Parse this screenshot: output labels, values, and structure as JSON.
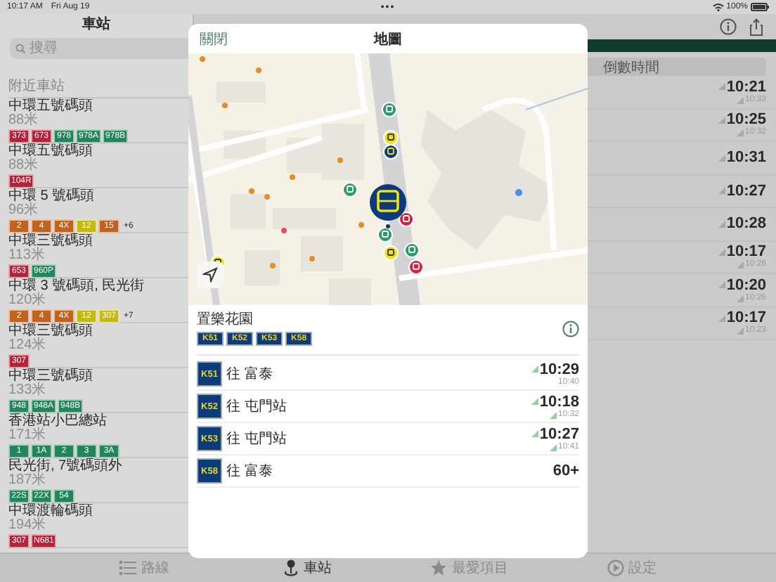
{
  "status_bar": {
    "time": "10:17 AM",
    "date": "Fri Aug 19",
    "dots": "•••",
    "battery": "100%"
  },
  "sidebar": {
    "title": "車站",
    "search": {
      "placeholder": "搜尋"
    },
    "section": "附近車站",
    "stops": [
      {
        "name": "中環五號碼頭",
        "distance": "88米",
        "routes": [
          {
            "label": "373",
            "color": "#b3243a"
          },
          {
            "label": "673",
            "color": "#b3243a"
          },
          {
            "label": "978",
            "color": "#23865a"
          },
          {
            "label": "978A",
            "color": "#23865a"
          },
          {
            "label": "978B",
            "color": "#23865a"
          }
        ]
      },
      {
        "name": "中環五號碼頭",
        "distance": "88米",
        "routes": [
          {
            "label": "104R",
            "color": "#b3243a"
          }
        ]
      },
      {
        "name": "中環 5 號碼頭",
        "distance": "96米",
        "routes": [
          {
            "label": "2",
            "color": "#c2621f"
          },
          {
            "label": "4",
            "color": "#c2621f"
          },
          {
            "label": "4X",
            "color": "#c2621f"
          },
          {
            "label": "12",
            "color": "#c4b812"
          },
          {
            "label": "15",
            "color": "#c2621f"
          }
        ],
        "more": "+6"
      },
      {
        "name": "中環三號碼頭",
        "distance": "113米",
        "routes": [
          {
            "label": "653",
            "color": "#b3243a"
          },
          {
            "label": "960P",
            "color": "#23865a"
          }
        ]
      },
      {
        "name": "中環 3 號碼頭, 民光街",
        "distance": "120米",
        "routes": [
          {
            "label": "2",
            "color": "#c2621f"
          },
          {
            "label": "4",
            "color": "#c2621f"
          },
          {
            "label": "4X",
            "color": "#c2621f"
          },
          {
            "label": "12",
            "color": "#c4b812"
          },
          {
            "label": "307",
            "color": "#c4b812"
          }
        ],
        "more": "+7"
      },
      {
        "name": "中環三號碼頭",
        "distance": "124米",
        "routes": [
          {
            "label": "307",
            "color": "#b3243a"
          }
        ]
      },
      {
        "name": "中環三號碼頭",
        "distance": "133米",
        "routes": [
          {
            "label": "948",
            "color": "#23865a"
          },
          {
            "label": "948A",
            "color": "#23865a"
          },
          {
            "label": "948B",
            "color": "#23865a"
          }
        ]
      },
      {
        "name": "香港站小巴總站",
        "distance": "171米",
        "routes": [
          {
            "label": "1",
            "color": "#23865a"
          },
          {
            "label": "1A",
            "color": "#23865a"
          },
          {
            "label": "2",
            "color": "#23865a"
          },
          {
            "label": "3",
            "color": "#23865a"
          },
          {
            "label": "3A",
            "color": "#23865a"
          }
        ]
      },
      {
        "name": "民光街, 7號碼頭外",
        "distance": "187米",
        "routes": [
          {
            "label": "22S",
            "color": "#23865a"
          },
          {
            "label": "22X",
            "color": "#23865a"
          },
          {
            "label": "54",
            "color": "#23865a"
          }
        ]
      },
      {
        "name": "中環渡輪碼頭",
        "distance": "194米",
        "routes": [
          {
            "label": "307",
            "color": "#b3243a"
          },
          {
            "label": "N681",
            "color": "#b3243a"
          }
        ]
      }
    ]
  },
  "detail": {
    "segment": "倒數時間",
    "etas": [
      {
        "time": "10:21",
        "next": "10:33"
      },
      {
        "time": "10:25",
        "next": "10:32"
      },
      {
        "time": "10:31"
      },
      {
        "time": "10:27"
      },
      {
        "time": "10:28"
      },
      {
        "time": "10:17",
        "next": "10:28"
      },
      {
        "time": "10:20",
        "next": "10:26"
      },
      {
        "time": "10:17",
        "next": "10:23"
      }
    ]
  },
  "map_sheet": {
    "close": "關閉",
    "title": "地圖",
    "stop": {
      "name": "置樂花園",
      "routes": [
        "K51",
        "K52",
        "K53",
        "K58"
      ]
    },
    "etas": [
      {
        "route": "K51",
        "destination": "往 富泰",
        "time": "10:29",
        "live": true,
        "next": "10:40",
        "next_live": false
      },
      {
        "route": "K52",
        "destination": "往 屯門站",
        "time": "10:18",
        "live": true,
        "next": "10:32",
        "next_live": true
      },
      {
        "route": "K53",
        "destination": "往 屯門站",
        "time": "10:27",
        "live": true,
        "next": "10:41",
        "next_live": true
      },
      {
        "route": "K58",
        "destination": "往 富泰",
        "time": "60+",
        "live": false
      }
    ]
  },
  "tab_bar": [
    {
      "label": "路線",
      "selected": false
    },
    {
      "label": "車站",
      "selected": true
    },
    {
      "label": "最愛項目",
      "selected": false
    },
    {
      "label": "設定",
      "selected": false
    }
  ]
}
